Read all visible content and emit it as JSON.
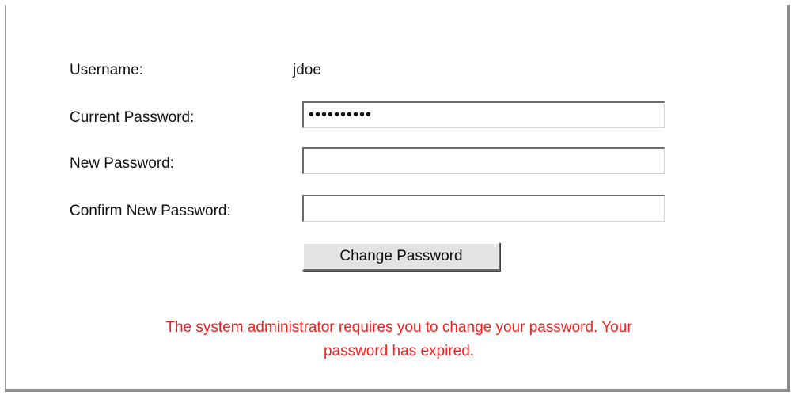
{
  "form": {
    "username_label": "Username:",
    "username_value": "jdoe",
    "current_password_label": "Current Password:",
    "current_password_value": "••••••••••",
    "new_password_label": "New Password:",
    "new_password_value": "",
    "confirm_password_label": "Confirm New Password:",
    "confirm_password_value": "",
    "submit_label": "Change Password"
  },
  "message": {
    "line1": "The system administrator requires you to change your password. Your",
    "line2": "password has expired.",
    "color": "#ff1a1a"
  }
}
